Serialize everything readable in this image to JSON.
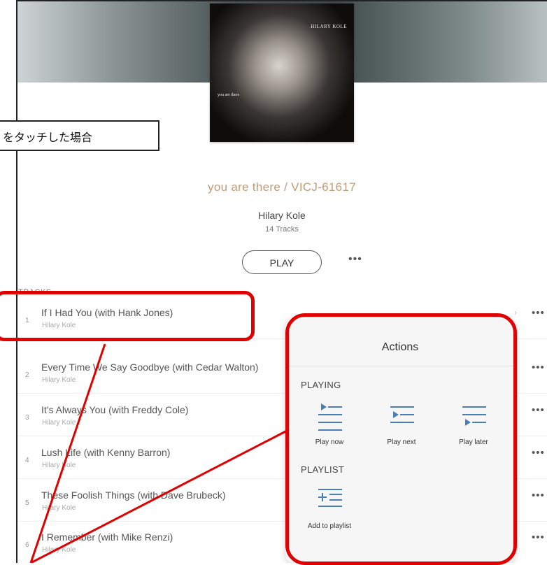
{
  "callout": {
    "text": "をタッチした場合"
  },
  "album": {
    "art_artist": "HILARY KOLE",
    "art_subtitle": "you are there",
    "title": "you are there / VICJ-61617",
    "artist": "Hilary Kole",
    "track_count": "14 Tracks",
    "play_label": "PLAY",
    "more_label": "•••"
  },
  "tracks_label": "TRACKS",
  "tracks": [
    {
      "num": "1",
      "title": "If I Had You (with Hank Jones)",
      "artist": "Hilary Kole"
    },
    {
      "num": "2",
      "title": "Every Time We Say Goodbye (with Cedar Walton)",
      "artist": "Hilary Kole"
    },
    {
      "num": "3",
      "title": "It's Always You (with Freddy Cole)",
      "artist": "Hilary Kole"
    },
    {
      "num": "4",
      "title": "Lush Life (with Kenny Barron)",
      "artist": "Hilary Kole"
    },
    {
      "num": "5",
      "title": "These Foolish Things (with Dave Brubeck)",
      "artist": "Hilary Kole"
    },
    {
      "num": "6",
      "title": "I Remember (with Mike Renzi)",
      "artist": "Hilary Kole"
    }
  ],
  "track_more_label": "•••",
  "actions": {
    "title": "Actions",
    "playing_label": "PLAYING",
    "play_now": "Play now",
    "play_next": "Play next",
    "play_later": "Play later",
    "playlist_label": "PLAYLIST",
    "add_to_playlist": "Add to playlist"
  },
  "colors": {
    "accent": "#c29b74",
    "icon": "#4a7fb5",
    "highlight": "#e00000"
  }
}
